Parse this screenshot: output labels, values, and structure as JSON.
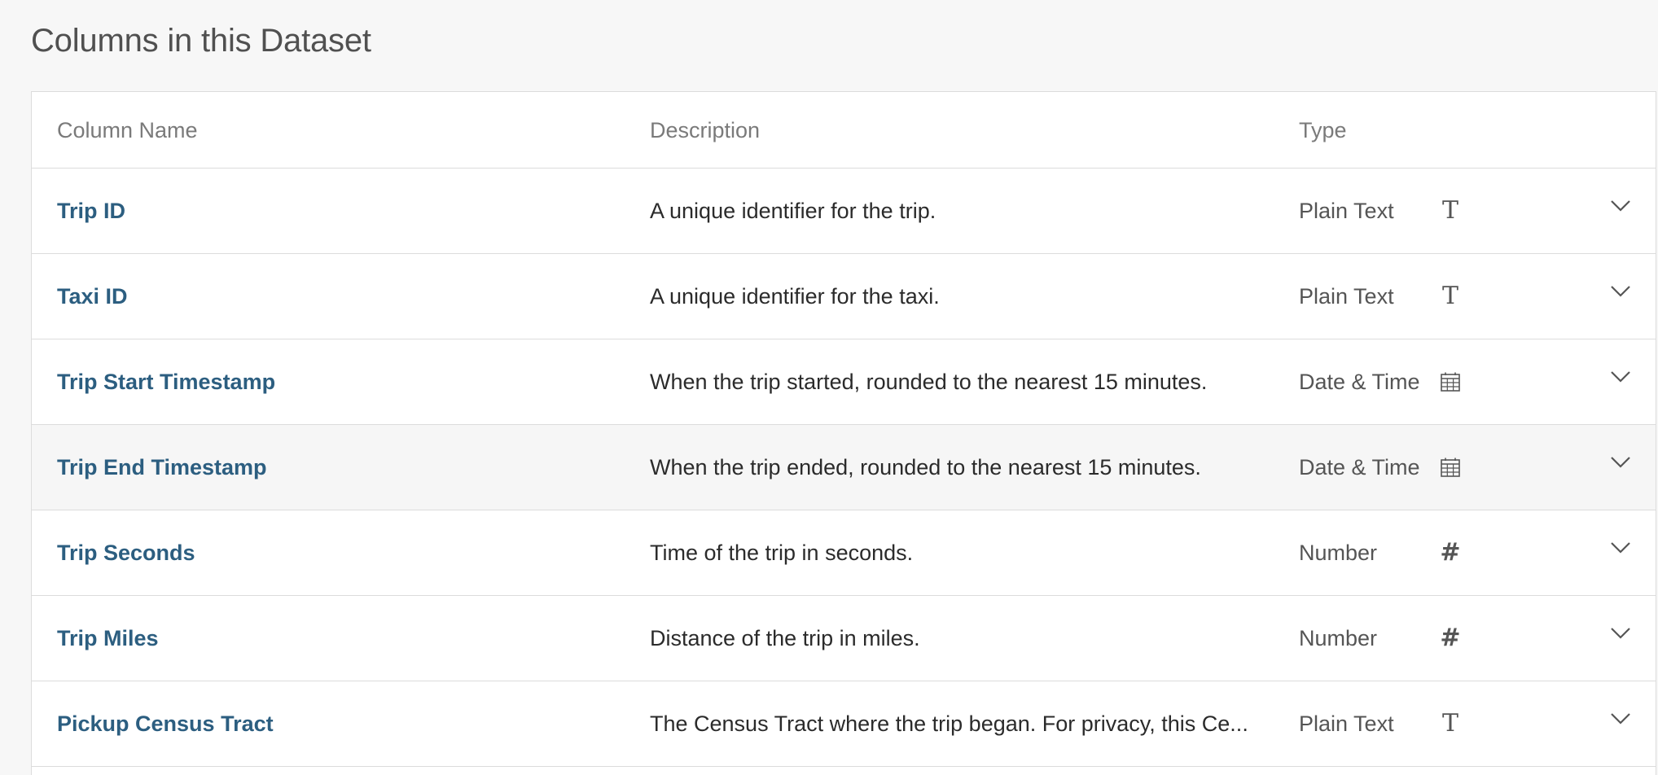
{
  "section": {
    "title": "Columns in this Dataset"
  },
  "table": {
    "headers": {
      "name": "Column Name",
      "description": "Description",
      "type": "Type"
    },
    "rows": [
      {
        "name": "Trip ID",
        "description": "A unique identifier for the trip.",
        "type": "Plain Text",
        "icon": "text-type-icon"
      },
      {
        "name": "Taxi ID",
        "description": "A unique identifier for the taxi.",
        "type": "Plain Text",
        "icon": "text-type-icon"
      },
      {
        "name": "Trip Start Timestamp",
        "description": "When the trip started, rounded to the nearest 15 minutes.",
        "type": "Date & Time",
        "icon": "calendar-icon"
      },
      {
        "name": "Trip End Timestamp",
        "description": "When the trip ended, rounded to the nearest 15 minutes.",
        "type": "Date & Time",
        "icon": "calendar-icon"
      },
      {
        "name": "Trip Seconds",
        "description": "Time of the trip in seconds.",
        "type": "Number",
        "icon": "number-hash-icon"
      },
      {
        "name": "Trip Miles",
        "description": "Distance of the trip in miles.",
        "type": "Number",
        "icon": "number-hash-icon"
      },
      {
        "name": "Pickup Census Tract",
        "description": "The Census Tract where the trip began. For privacy, this Ce...",
        "type": "Plain Text",
        "icon": "text-type-icon"
      }
    ]
  },
  "colors": {
    "link": "#2c5e80",
    "border": "#dcdcdc",
    "page_background": "#f7f7f7",
    "hover_row": "#f6f6f6"
  }
}
